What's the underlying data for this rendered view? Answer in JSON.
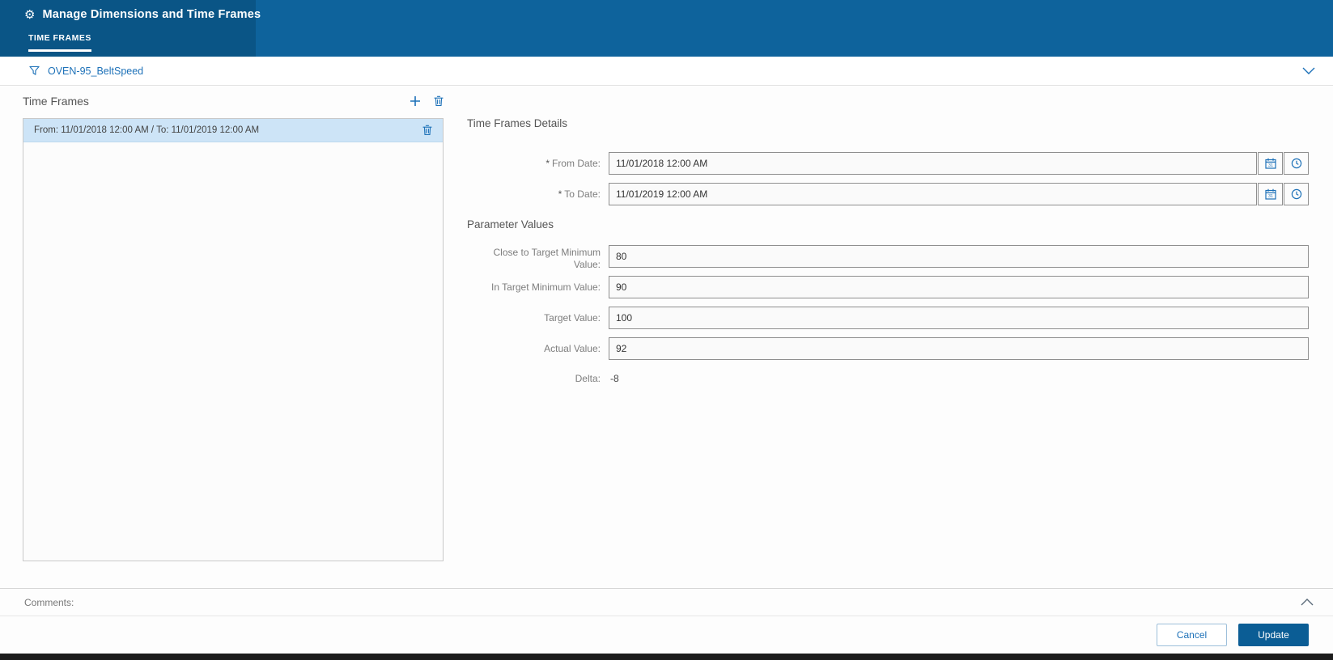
{
  "header": {
    "title": "Manage Dimensions and Time Frames",
    "tab": "TIME FRAMES"
  },
  "dimension": {
    "name": "OVEN-95_BeltSpeed"
  },
  "timeframes": {
    "panel_title": "Time Frames",
    "items": [
      {
        "label": "From: 11/01/2018 12:00 AM  /  To: 11/01/2019 12:00 AM"
      }
    ]
  },
  "details": {
    "title": "Time Frames Details",
    "required_marker": "*",
    "from_label": "From Date:",
    "from_value": "11/01/2018 12:00 AM",
    "to_label": "To Date:",
    "to_value": "11/01/2019 12:00 AM"
  },
  "parameters": {
    "title": "Parameter Values",
    "fields": [
      {
        "label": "Close to Target Minimum Value:",
        "value": "80"
      },
      {
        "label": "In Target Minimum Value:",
        "value": "90"
      },
      {
        "label": "Target Value:",
        "value": "100"
      },
      {
        "label": "Actual Value:",
        "value": "92"
      }
    ],
    "delta_label": "Delta:",
    "delta_value": "-8"
  },
  "comments": {
    "label": "Comments:"
  },
  "footer": {
    "cancel": "Cancel",
    "update": "Update"
  },
  "colors": {
    "header_blue": "#0e639c",
    "header_blue_dark": "#0a5586",
    "accent_blue": "#1d71b8",
    "selected_row": "#cde4f7",
    "update_button": "#0b5d95"
  }
}
